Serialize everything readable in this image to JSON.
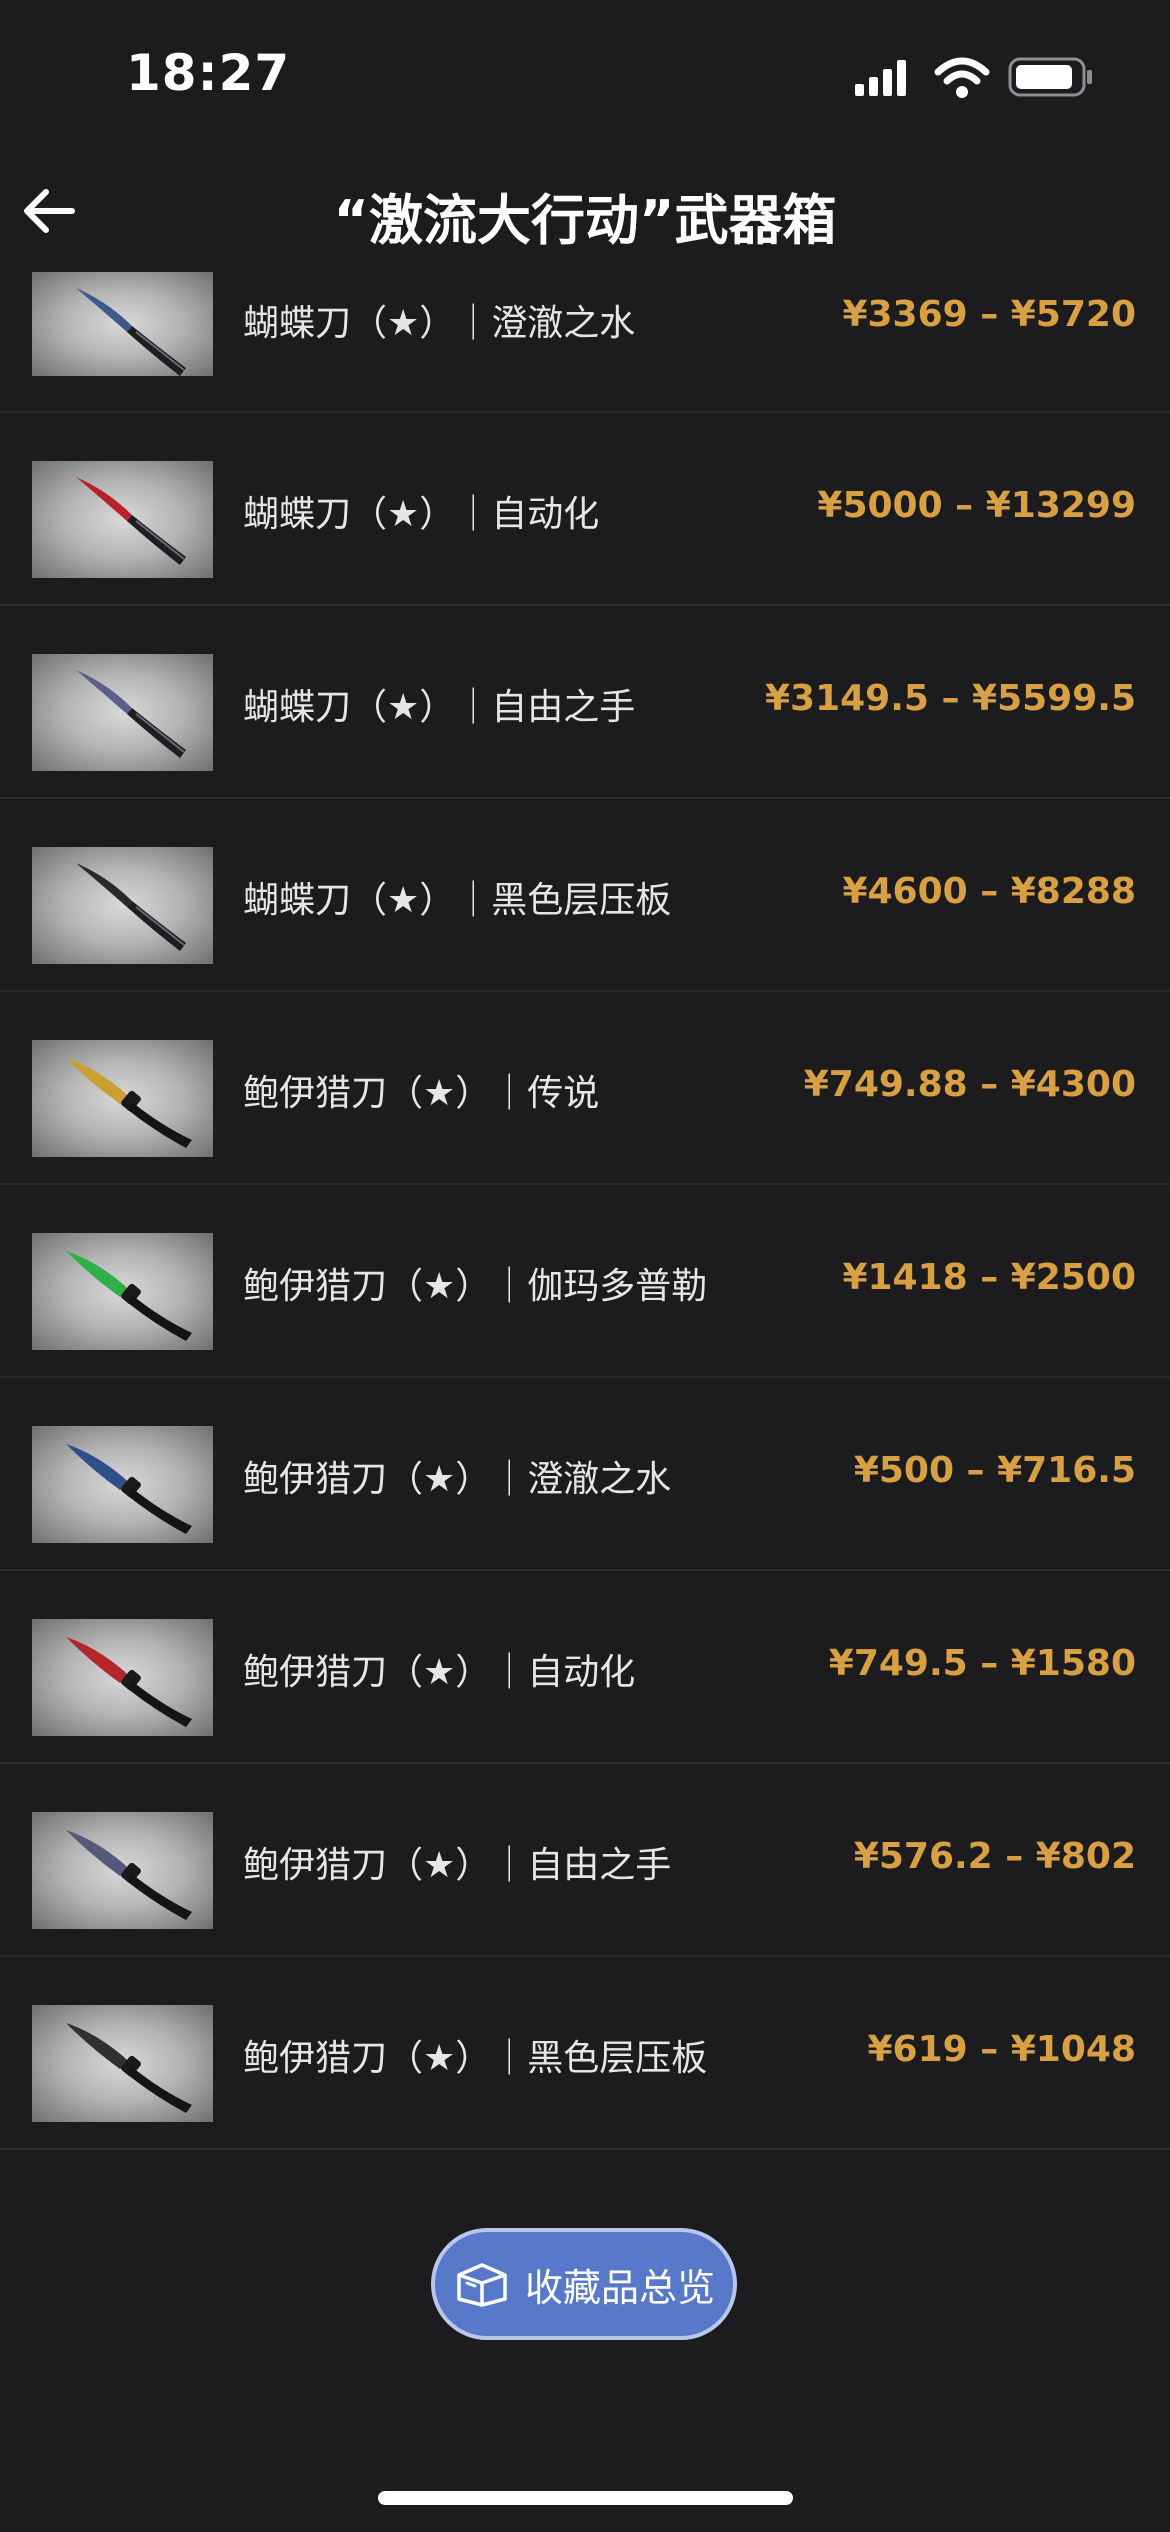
{
  "status_bar": {
    "time": "18:27"
  },
  "header": {
    "title": "“激流大行动”武器箱"
  },
  "items": [
    {
      "name": "蝴蝶刀（★）｜澄澈之水",
      "price": "¥3369 – ¥5720",
      "blade_color": "#3d5a8a"
    },
    {
      "name": "蝴蝶刀（★）｜自动化",
      "price": "¥5000 – ¥13299",
      "blade_color": "#b8202a"
    },
    {
      "name": "蝴蝶刀（★）｜自由之手",
      "price": "¥3149.5 – ¥5599.5",
      "blade_color": "#5c5f8a"
    },
    {
      "name": "蝴蝶刀（★）｜黑色层压板",
      "price": "¥4600 – ¥8288",
      "blade_color": "#2a2a2a"
    },
    {
      "name": "鲍伊猎刀（★）｜传说",
      "price": "¥749.88 – ¥4300",
      "blade_color": "#c9a031"
    },
    {
      "name": "鲍伊猎刀（★）｜伽玛多普勒",
      "price": "¥1418 – ¥2500",
      "blade_color": "#2fae4a"
    },
    {
      "name": "鲍伊猎刀（★）｜澄澈之水",
      "price": "¥500 – ¥716.5",
      "blade_color": "#2f4f86"
    },
    {
      "name": "鲍伊猎刀（★）｜自动化",
      "price": "¥749.5 – ¥1580",
      "blade_color": "#b3262c"
    },
    {
      "name": "鲍伊猎刀（★）｜自由之手",
      "price": "¥576.2 – ¥802",
      "blade_color": "#55587a"
    },
    {
      "name": "鲍伊猎刀（★）｜黑色层压板",
      "price": "¥619 – ¥1048",
      "blade_color": "#303030"
    }
  ],
  "collection_button": {
    "label": "收藏品总览"
  },
  "colors": {
    "price": "#d9a043",
    "button": "#5878c9",
    "background": "#1c1c1e"
  }
}
